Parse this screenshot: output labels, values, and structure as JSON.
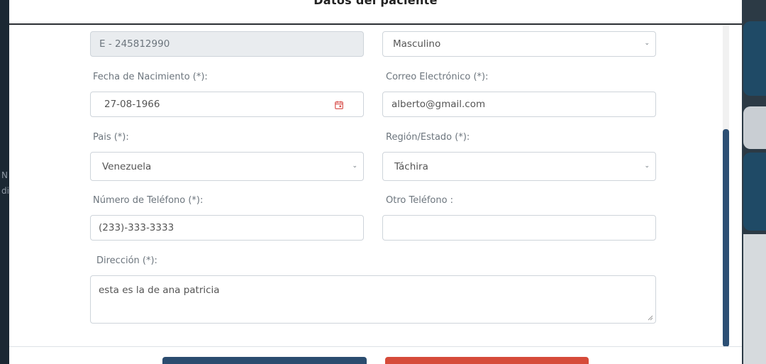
{
  "background": {
    "left_text_lines": [
      "N",
      "di"
    ]
  },
  "modal": {
    "title": "Datos del paciente"
  },
  "form": {
    "cedula": {
      "value": "E - 245812990"
    },
    "sexo": {
      "value": "Masculino"
    },
    "fecha_nacimiento": {
      "label": "Fecha de Nacimiento (*):",
      "value": "27-08-1966"
    },
    "correo": {
      "label": "Correo Electrónico (*):",
      "value": "alberto@gmail.com"
    },
    "pais": {
      "label": "Pais (*):",
      "value": "Venezuela"
    },
    "region": {
      "label": "Región/Estado (*):",
      "value": "Táchira"
    },
    "telefono": {
      "label": "Número de Teléfono (*):",
      "value": "(233)-333-3333"
    },
    "otro_telefono": {
      "label": "Otro Teléfono :",
      "value": ""
    },
    "direccion": {
      "label": "Dirección (*):",
      "value": "esta es la de ana patricia"
    }
  },
  "colors": {
    "primary": "#2b4c6f",
    "danger": "#d64b3a",
    "scrollbar": "#2c4f74",
    "calendar_icon": "#d9534f"
  },
  "icons": {
    "calendar": "calendar-icon",
    "chevron": "chevron-down-icon"
  }
}
